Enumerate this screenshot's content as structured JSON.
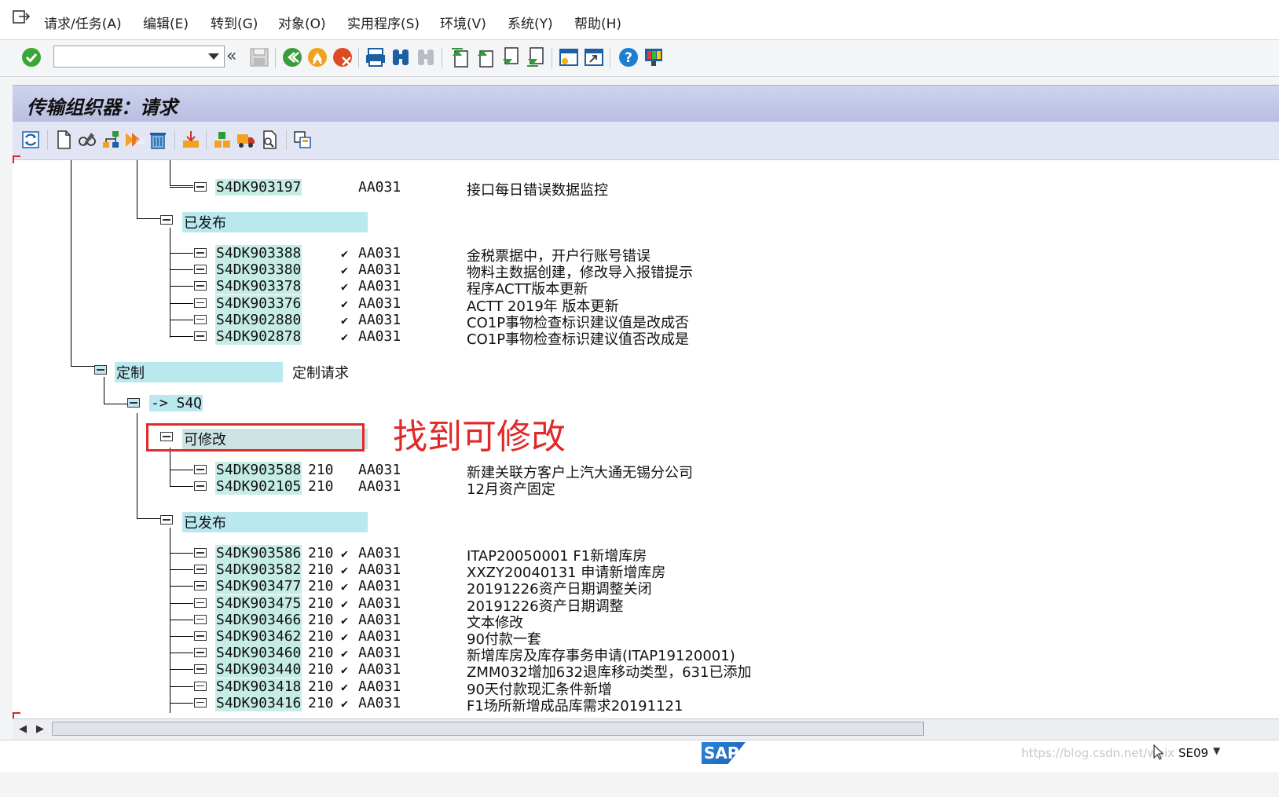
{
  "menu": [
    {
      "label": "请求/任务(A)"
    },
    {
      "label": "编辑(E)"
    },
    {
      "label": "转到(G)"
    },
    {
      "label": "对象(O)"
    },
    {
      "label": "实用程序(S)"
    },
    {
      "label": "环境(V)"
    },
    {
      "label": "系统(Y)"
    },
    {
      "label": "帮助(H)"
    }
  ],
  "command_field": {
    "value": ""
  },
  "title": "传输组织器：请求",
  "tree": {
    "top_request": {
      "id": "S4DK903197",
      "owner": "AA031",
      "desc": "接口每日错误数据监控"
    },
    "released_label_1": "已发布",
    "released_1": [
      {
        "id": "S4DK903388",
        "check": "✔",
        "owner": "AA031",
        "desc": "金税票据中，开户行账号错误"
      },
      {
        "id": "S4DK903380",
        "check": "✔",
        "owner": "AA031",
        "desc": "物料主数据创建，修改导入报错提示"
      },
      {
        "id": "S4DK903378",
        "check": "✔",
        "owner": "AA031",
        "desc": "程序ACTT版本更新"
      },
      {
        "id": "S4DK903376",
        "check": "✔",
        "owner": "AA031",
        "desc": "ACTT  2019年  版本更新"
      },
      {
        "id": "S4DK902880",
        "check": "✔",
        "owner": "AA031",
        "desc": "CO1P事物检查标识建议值是改成否"
      },
      {
        "id": "S4DK902878",
        "check": "✔",
        "owner": "AA031",
        "desc": "CO1P事物检查标识建议值否改成是"
      }
    ],
    "customizing_label": "定制",
    "customizing_desc": "定制请求",
    "target_label": "-> S4Q",
    "modifiable_label": "可修改",
    "modifiable": [
      {
        "id": "S4DK903588",
        "count": "210",
        "owner": "AA031",
        "desc": "新建关联方客户上汽大通无锡分公司"
      },
      {
        "id": "S4DK902105",
        "count": "210",
        "owner": "AA031",
        "desc": "12月资产固定"
      }
    ],
    "released_label_2": "已发布",
    "released_2": [
      {
        "id": "S4DK903586",
        "count": "210",
        "check": "✔",
        "owner": "AA031",
        "desc": "ITAP20050001  F1新增库房"
      },
      {
        "id": "S4DK903582",
        "count": "210",
        "check": "✔",
        "owner": "AA031",
        "desc": "XXZY20040131  申请新增库房"
      },
      {
        "id": "S4DK903477",
        "count": "210",
        "check": "✔",
        "owner": "AA031",
        "desc": "20191226资产日期调整关闭"
      },
      {
        "id": "S4DK903475",
        "count": "210",
        "check": "✔",
        "owner": "AA031",
        "desc": "20191226资产日期调整"
      },
      {
        "id": "S4DK903466",
        "count": "210",
        "check": "✔",
        "owner": "AA031",
        "desc": "文本修改"
      },
      {
        "id": "S4DK903462",
        "count": "210",
        "check": "✔",
        "owner": "AA031",
        "desc": "90付款一套"
      },
      {
        "id": "S4DK903460",
        "count": "210",
        "check": "✔",
        "owner": "AA031",
        "desc": "新增库房及库存事务申请(ITAP19120001)"
      },
      {
        "id": "S4DK903440",
        "count": "210",
        "check": "✔",
        "owner": "AA031",
        "desc": "ZMM032增加632退库移动类型，631已添加"
      },
      {
        "id": "S4DK903418",
        "count": "210",
        "check": "✔",
        "owner": "AA031",
        "desc": "90天付款现汇条件新增"
      },
      {
        "id": "S4DK903416",
        "count": "210",
        "check": "✔",
        "owner": "AA031",
        "desc": "F1场所新增成品库需求20191121"
      }
    ]
  },
  "annotation": {
    "text": "找到可修改"
  },
  "status": {
    "watermark": "https://blog.csdn.net/weix",
    "tcode": "SE09"
  },
  "icons": [
    "exit-icon",
    "enter-icon",
    "back-icon",
    "save-icon",
    "back-green-icon",
    "exit-orange-icon",
    "cancel-red-icon",
    "print-icon",
    "find-icon",
    "find-next-icon",
    "first-page-icon",
    "prev-page-icon",
    "next-page-icon",
    "last-page-icon",
    "new-session-icon",
    "shortcut-icon",
    "help-icon",
    "customize-layout-icon"
  ],
  "colors": {
    "title_bar": "#c3c8e8",
    "tree_highlight": "#bfe9f2",
    "annotation": "#e02a2a"
  }
}
